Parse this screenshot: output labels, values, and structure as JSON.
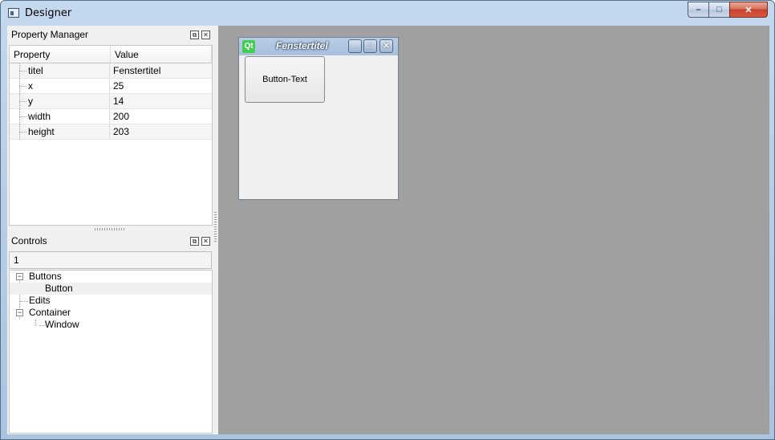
{
  "window": {
    "title": "Designer",
    "caption_buttons": {
      "minimize": "–",
      "maximize": "□",
      "close": "✕"
    }
  },
  "property_manager": {
    "title": "Property Manager",
    "float_icon": "⧉",
    "close_icon": "✕",
    "columns": [
      "Property",
      "Value"
    ],
    "rows": [
      {
        "property": "titel",
        "value": "Fenstertitel"
      },
      {
        "property": "x",
        "value": "25"
      },
      {
        "property": "y",
        "value": "14"
      },
      {
        "property": "width",
        "value": "200"
      },
      {
        "property": "height",
        "value": "203"
      }
    ]
  },
  "controls": {
    "title": "Controls",
    "float_icon": "⧉",
    "close_icon": "✕",
    "search_value": "1",
    "tree": {
      "buttons": "Buttons",
      "button": "Button",
      "edits": "Edits",
      "container": "Container",
      "window": "Window"
    },
    "collapse_symbol": "−"
  },
  "mdi_subwindow": {
    "logo": "Qt",
    "title": "Fenstertitel",
    "buttons": {
      "minimize": "_",
      "maximize": "□",
      "close": "✕"
    },
    "child_button_text": "Button-Text"
  }
}
